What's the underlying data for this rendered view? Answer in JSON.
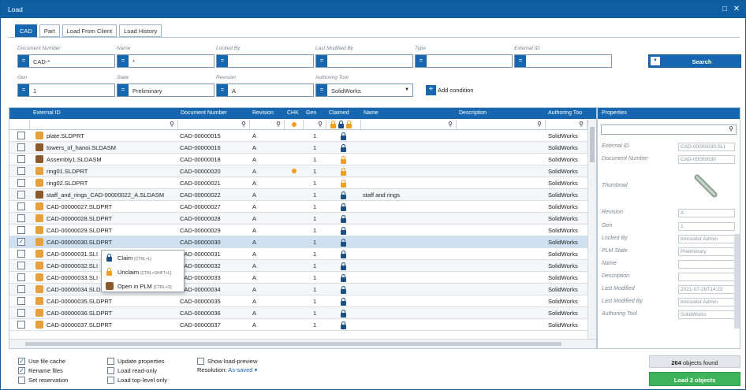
{
  "window": {
    "title": "Load",
    "minimize": "□",
    "close": "✕"
  },
  "tabs": [
    {
      "label": "CAD"
    },
    {
      "label": "Part"
    },
    {
      "label": "Load From Client"
    },
    {
      "label": "Load History"
    }
  ],
  "search": {
    "fields": [
      {
        "label": "Document Number",
        "value": "CAD-*",
        "dropdown": false
      },
      {
        "label": "Name",
        "value": "*",
        "dropdown": false
      },
      {
        "label": "Locked By",
        "value": "",
        "dropdown": false
      },
      {
        "label": "Last Modified By",
        "value": "",
        "dropdown": false
      },
      {
        "label": "Type",
        "value": "",
        "dropdown": false
      },
      {
        "label": "External ID",
        "value": "",
        "dropdown": false
      },
      {
        "label": "Gen",
        "value": "1",
        "dropdown": false
      },
      {
        "label": "State",
        "value": "Preliminary",
        "dropdown": false
      },
      {
        "label": "Revision",
        "value": "A",
        "dropdown": false
      },
      {
        "label": "Authoring Tool",
        "value": "SolidWorks",
        "dropdown": true
      }
    ],
    "equals_icon": "=",
    "search_button": "Search",
    "add_condition": "Add condition"
  },
  "grid": {
    "columns": [
      "External ID",
      "Document Number",
      "Revision",
      "CHK",
      "Gen",
      "Claimed",
      "Name",
      "Description",
      "Authoring Too"
    ],
    "rows": [
      {
        "checked": false,
        "icon": "part",
        "external_id": "plate.SLDPRT",
        "doc": "CAD-00000015",
        "rev": "A",
        "chk": false,
        "gen": "1",
        "claimed": "blue",
        "name": "",
        "desc": "",
        "tool": "SolidWorks"
      },
      {
        "checked": false,
        "icon": "assembly",
        "external_id": "towers_of_hanoi.SLDASM",
        "doc": "CAD-00000016",
        "rev": "A",
        "chk": false,
        "gen": "1",
        "claimed": "blue",
        "name": "",
        "desc": "",
        "tool": "SolidWorks"
      },
      {
        "checked": false,
        "icon": "assembly",
        "external_id": "Assembly1.SLDASM",
        "doc": "CAD-00000018",
        "rev": "A",
        "chk": false,
        "gen": "1",
        "claimed": "orange",
        "name": "",
        "desc": "",
        "tool": "SolidWorks"
      },
      {
        "checked": false,
        "icon": "part",
        "external_id": "ring01.SLDPRT",
        "doc": "CAD-00000020",
        "rev": "A",
        "chk": true,
        "gen": "1",
        "claimed": "orange",
        "name": "",
        "desc": "",
        "tool": "SolidWorks"
      },
      {
        "checked": false,
        "icon": "part",
        "external_id": "ring02.SLDPRT",
        "doc": "CAD-00000021",
        "rev": "A",
        "chk": false,
        "gen": "1",
        "claimed": "orange-user",
        "name": "",
        "desc": "",
        "tool": "SolidWorks"
      },
      {
        "checked": false,
        "icon": "assembly",
        "external_id": "staff_and_rings_CAD-00000022_A.SLDASM",
        "doc": "CAD-00000022",
        "rev": "A",
        "chk": false,
        "gen": "1",
        "claimed": "blue",
        "name": "staff and rings",
        "desc": "",
        "tool": "SolidWorks"
      },
      {
        "checked": false,
        "icon": "part",
        "external_id": "CAD-00000027.SLDPRT",
        "doc": "CAD-00000027",
        "rev": "A",
        "chk": false,
        "gen": "1",
        "claimed": "blue",
        "name": "",
        "desc": "",
        "tool": "SolidWorks"
      },
      {
        "checked": false,
        "icon": "part",
        "external_id": "CAD-00000028.SLDPRT",
        "doc": "CAD-00000028",
        "rev": "A",
        "chk": false,
        "gen": "1",
        "claimed": "blue",
        "name": "",
        "desc": "",
        "tool": "SolidWorks"
      },
      {
        "checked": false,
        "icon": "part",
        "external_id": "CAD-00000029.SLDPRT",
        "doc": "CAD-00000029",
        "rev": "A",
        "chk": false,
        "gen": "1",
        "claimed": "blue",
        "name": "",
        "desc": "",
        "tool": "SolidWorks"
      },
      {
        "checked": true,
        "icon": "part",
        "external_id": "CAD-00000030.SLDPRT",
        "doc": "CAD-00000030",
        "rev": "A",
        "chk": false,
        "gen": "1",
        "claimed": "blue",
        "name": "",
        "desc": "",
        "tool": "SolidWorks"
      },
      {
        "checked": false,
        "icon": "part",
        "external_id": "CAD-00000031.SLI",
        "doc": "CAD-00000031",
        "rev": "A",
        "chk": false,
        "gen": "1",
        "claimed": "blue",
        "name": "",
        "desc": "",
        "tool": "SolidWorks"
      },
      {
        "checked": false,
        "icon": "part",
        "external_id": "CAD-00000032.SLI",
        "doc": "CAD-00000032",
        "rev": "A",
        "chk": false,
        "gen": "1",
        "claimed": "blue",
        "name": "",
        "desc": "",
        "tool": "SolidWorks"
      },
      {
        "checked": false,
        "icon": "part",
        "external_id": "CAD-00000033.SLI",
        "doc": "CAD-00000033",
        "rev": "A",
        "chk": false,
        "gen": "1",
        "claimed": "blue",
        "name": "",
        "desc": "",
        "tool": "SolidWorks"
      },
      {
        "checked": false,
        "icon": "part",
        "external_id": "CAD-00000034.SLDPRT",
        "doc": "CAD-00000034",
        "rev": "A",
        "chk": false,
        "gen": "1",
        "claimed": "blue",
        "name": "",
        "desc": "",
        "tool": "SolidWorks"
      },
      {
        "checked": false,
        "icon": "part",
        "external_id": "CAD-00000035.SLDPRT",
        "doc": "CAD-00000035",
        "rev": "A",
        "chk": false,
        "gen": "1",
        "claimed": "blue",
        "name": "",
        "desc": "",
        "tool": "SolidWorks"
      },
      {
        "checked": false,
        "icon": "part",
        "external_id": "CAD-00000036.SLDPRT",
        "doc": "CAD-00000036",
        "rev": "A",
        "chk": false,
        "gen": "1",
        "claimed": "blue",
        "name": "",
        "desc": "",
        "tool": "SolidWorks"
      },
      {
        "checked": false,
        "icon": "part",
        "external_id": "CAD-00000037.SLDPRT",
        "doc": "CAD-00000037",
        "rev": "A",
        "chk": false,
        "gen": "1",
        "claimed": "blue",
        "name": "",
        "desc": "",
        "tool": "SolidWorks"
      }
    ]
  },
  "context_menu": {
    "items": [
      {
        "label": "Claim",
        "shortcut": "[CTRL+L]",
        "icon": "lock-icon"
      },
      {
        "label": "Unclaim",
        "shortcut": "[CTRL+SHIFT+L]",
        "icon": "unlock-icon"
      },
      {
        "label": "Open in PLM",
        "shortcut": "[CTRL+O]",
        "icon": "open-plm-icon"
      }
    ]
  },
  "properties": {
    "title": "Properties",
    "fields": [
      {
        "label": "External ID",
        "value": "CAD-00000030.SLI"
      },
      {
        "label": "Document Number",
        "value": "CAD-00000030"
      },
      {
        "label": "Thumbnail",
        "value": ""
      },
      {
        "label": "Revision",
        "value": "A"
      },
      {
        "label": "Gen",
        "value": "1"
      },
      {
        "label": "Locked By",
        "value": "Innovator Admin"
      },
      {
        "label": "PLM State",
        "value": "Preliminary"
      },
      {
        "label": "Name",
        "value": ""
      },
      {
        "label": "Description",
        "value": ""
      },
      {
        "label": "Last Modified",
        "value": "2021-07-28T14:22"
      },
      {
        "label": "Last Modified By",
        "value": "Innovator Admin"
      },
      {
        "label": "Authoring Tool",
        "value": "SolidWorks"
      }
    ]
  },
  "options": [
    {
      "label": "Use file cache",
      "checked": true
    },
    {
      "label": "Rename files",
      "checked": true
    },
    {
      "label": "Set reservation",
      "checked": false
    },
    {
      "label": "Update properties",
      "checked": false
    },
    {
      "label": "Load read-only",
      "checked": false
    },
    {
      "label": "Load top-level only",
      "checked": false
    },
    {
      "label": "Show load-preview",
      "checked": false
    }
  ],
  "resolution": {
    "label": "Resolution:",
    "value": "As-saved",
    "caret": "▾"
  },
  "footer": {
    "count": "264",
    "found_text": "objects found",
    "load_button": "Load 2 objects"
  },
  "colors": {
    "accent": "#1667b0",
    "load_button": "#3fb35a",
    "lock_blue": "#1b4f86",
    "lock_orange": "#f0a020"
  }
}
